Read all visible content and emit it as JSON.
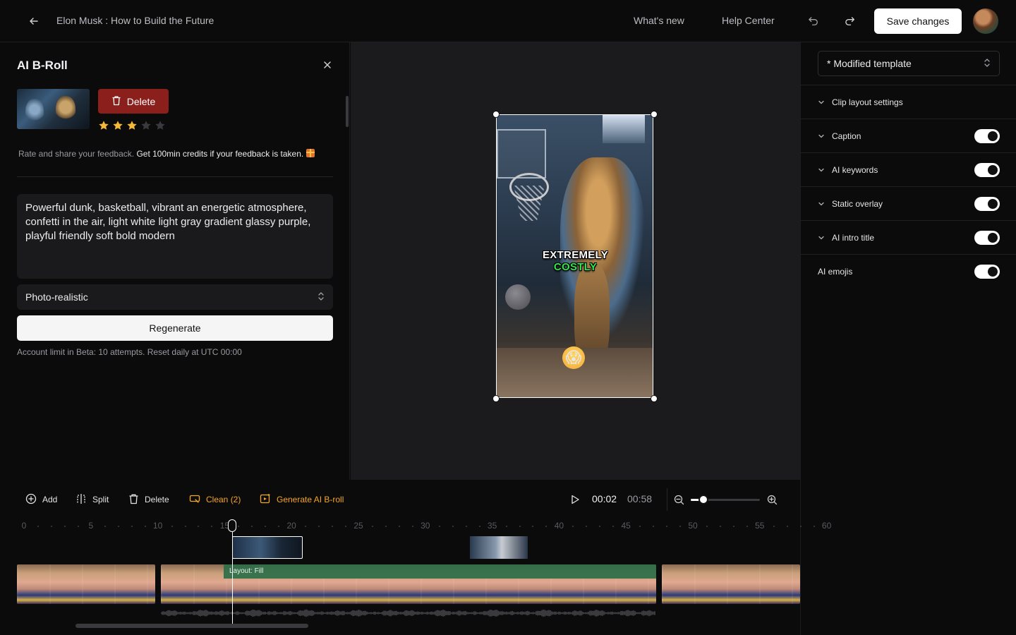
{
  "header": {
    "title": "Elon Musk : How to Build the Future",
    "whats_new": "What's new",
    "help_center": "Help Center",
    "save_label": "Save changes"
  },
  "broll_panel": {
    "title": "AI B-Roll",
    "delete_label": "Delete",
    "rating": 3,
    "rating_max": 5,
    "feedback_prefix": "Rate and share your feedback.",
    "feedback_bold": "Get 100min credits if your feedback is taken.",
    "prompt": "Powerful dunk, basketball, vibrant an energetic atmosphere, confetti in the air, light white light gray gradient glassy purple, playful friendly soft bold modern",
    "style_value": "Photo-realistic",
    "regenerate_label": "Regenerate",
    "limit_note": "Account limit in Beta: 10 attempts. Reset daily at UTC 00:00"
  },
  "preview": {
    "caption_line1": "EXTREMELY",
    "caption_line2": "COSTLY",
    "emoji": "😱"
  },
  "settings": {
    "template_value": "* Modified template",
    "rows": [
      {
        "label": "Clip layout settings",
        "chevron": true,
        "toggle": null
      },
      {
        "label": "Caption",
        "chevron": true,
        "toggle": true
      },
      {
        "label": "AI keywords",
        "chevron": true,
        "toggle": true
      },
      {
        "label": "Static overlay",
        "chevron": true,
        "toggle": true
      },
      {
        "label": "AI intro title",
        "chevron": true,
        "toggle": true
      },
      {
        "label": "AI emojis",
        "chevron": false,
        "toggle": true
      }
    ]
  },
  "timeline": {
    "add_label": "Add",
    "split_label": "Split",
    "delete_label": "Delete",
    "clean_label": "Clean (2)",
    "generate_label": "Generate AI B-roll",
    "current_time": "00:02",
    "total_time": "00:58",
    "zoom_level": 0.18,
    "ruler_labels": [
      "0",
      "5",
      "10",
      "15",
      "20",
      "25",
      "30",
      "35",
      "40",
      "45",
      "50",
      "55",
      "60"
    ],
    "layout_label": "Layout: Fill"
  },
  "colors": {
    "accent_orange": "#f5a623",
    "delete_red": "#8a1f1c",
    "star_gold": "#f5b93b",
    "layout_green": "#2c6e48",
    "caption_green": "#2fe84a"
  }
}
